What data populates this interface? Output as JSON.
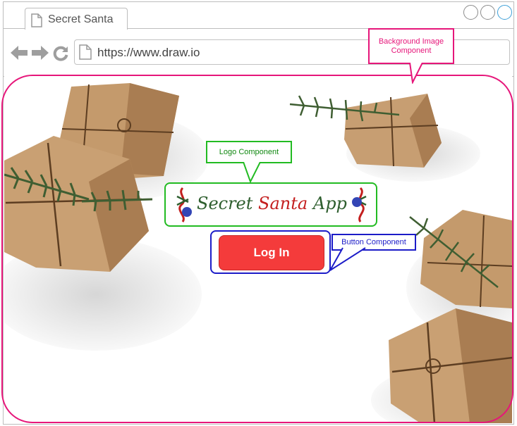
{
  "browser": {
    "tab_title": "Secret Santa",
    "url": "https://www.draw.io"
  },
  "logo": {
    "word1": "Secret",
    "word2": "Santa",
    "word3": "App"
  },
  "login_button": {
    "label": "Log In"
  },
  "annotations": {
    "background": "Background Image Component",
    "logo": "Logo Component",
    "button": "Button Component"
  },
  "colors": {
    "background_outline": "#e6167a",
    "logo_outline": "#22bb22",
    "button_outline": "#1c1cc8",
    "login_button_fill": "#f43b3b"
  },
  "icons": [
    "document-icon",
    "back-arrow-icon",
    "forward-arrow-icon",
    "reload-icon"
  ]
}
